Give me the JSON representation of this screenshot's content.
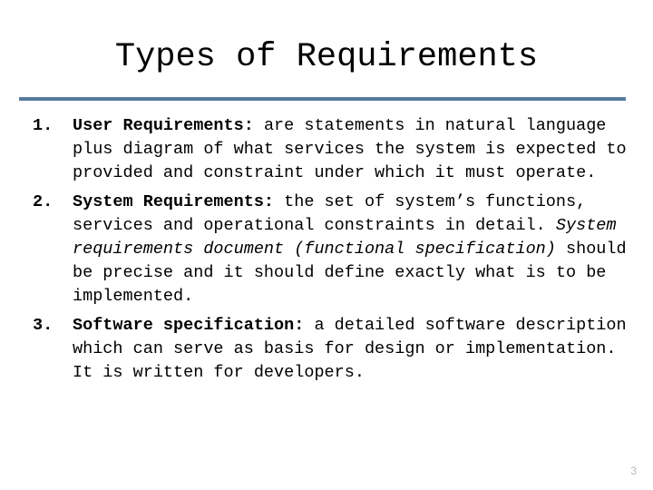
{
  "slide": {
    "title": "Types of Requirements",
    "page_number": "3",
    "accent_color": "#58799c",
    "page_number_color": "#b6b6bd",
    "text_color": "#000000",
    "background_color": "#ffffff"
  },
  "items": [
    {
      "marker": "1.",
      "term": "User Requirements:",
      "body": " are statements in natural language plus diagram of what services the system is expected to provided and constraint under which it must operate."
    },
    {
      "marker": "2.",
      "term": "System Requirements:",
      "body_part1": " the set of system’s functions, services and operational constraints in detail. ",
      "emphasis": "System requirements document (functional specification)",
      "body_part2": " should be precise and it should define exactly what is to be implemented."
    },
    {
      "marker": "3.",
      "term": "Software specification:",
      "body": " a detailed software description which can serve as basis for design or implementation. It is written for developers."
    }
  ]
}
